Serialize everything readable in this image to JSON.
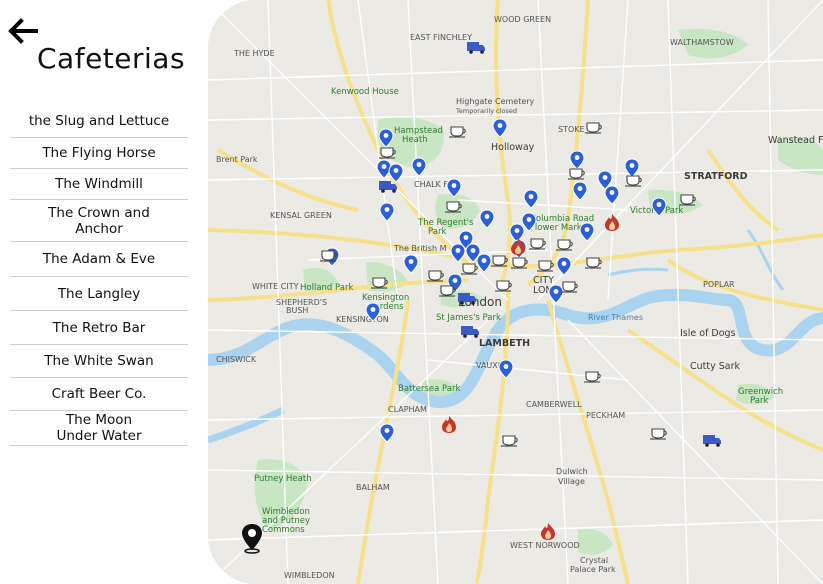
{
  "page": {
    "title": "Cafeterias",
    "back_icon": "arrow-left-icon"
  },
  "cafes": [
    {
      "name": "the Slug and Lettuce"
    },
    {
      "name": "The Flying Horse"
    },
    {
      "name": "The Windmill"
    },
    {
      "name": "The Crown and Anchor"
    },
    {
      "name": "The Adam & Eve"
    },
    {
      "name": "The Langley"
    },
    {
      "name": "The Retro Bar"
    },
    {
      "name": "The White Swan"
    },
    {
      "name": "Craft Beer Co."
    },
    {
      "name": "The Moon Under Water"
    }
  ],
  "map": {
    "colors": {
      "land": "#eceae4",
      "park": "#c8e6c4",
      "water": "#aad3f0",
      "major_road": "#f7e08a",
      "road": "#ffffff",
      "pin": "#2b5fd6",
      "pin_red": "#c0392b"
    },
    "labels": {
      "wood_green": "WOOD GREEN",
      "the_hyde": "THE HYDE",
      "east_finchley": "EAST FINCHLEY",
      "walthamstow": "WALTHAMSTOW",
      "kenwood": "Kenwood House",
      "highgate": "Highgate Cemetery",
      "highgate_sub": "Temporarily closed",
      "hampstead": "Hampstead",
      "hampstead2": "Heath",
      "holloway": "Holloway",
      "stoke": "STOKE",
      "brent_park": "Brent Park",
      "wanstead": "Wanstead Fl",
      "chalk_farm": "CHALK FA",
      "stratford": "STRATFORD",
      "kensal_green": "KENSAL GREEN",
      "regents": "The Regent's",
      "regents2": "Park",
      "columbia": "Columbia Road",
      "columbia2": "Flower Market",
      "victoria_park": "Victoria Park",
      "british_museum": "The British M",
      "holland_park": "Holland Park",
      "white_city": "WHITE CITY",
      "shepherds": "SHEPHERD'S",
      "shepherds2": "BUSH",
      "kensington": "Kensington",
      "kensington2": "Gardens",
      "kensington3": "KENSINGTON",
      "london": "London",
      "city": "CITY",
      "city2": "LON",
      "stjames": "St James's Park",
      "lambeth": "LAMBETH",
      "poplar": "POPLAR",
      "isle_dogs": "Isle of Dogs",
      "cutty": "Cutty Sark",
      "chiswick": "CHISWICK",
      "battersea": "Battersea Park",
      "vauxhall": "VAUXH",
      "greenwich": "Greenwich",
      "greenwich2": "Park",
      "clapham": "CLAPHAM",
      "peckham": "PECKHAM",
      "camberwell": "CAMBERWELL",
      "putney": "Putney Heath",
      "wimbledon": "Wimbledon",
      "wimbledon2": "and Putney",
      "wimbledon3": "Commons",
      "dulwich": "Dulwich",
      "dulwich2": "Village",
      "west_norwood": "WEST NORWOOD",
      "crystal": "Crystal",
      "crystal2": "Palace Park",
      "wimbledon_bottom": "WIMBLEDON",
      "balham": "BALHAM",
      "river_thames": "River Thames"
    },
    "icons": {
      "pin": "map-pin-icon",
      "cafe": "coffee-cup-icon",
      "truck": "truck-icon",
      "fire": "fire-icon",
      "location": "location-pin-icon"
    }
  }
}
